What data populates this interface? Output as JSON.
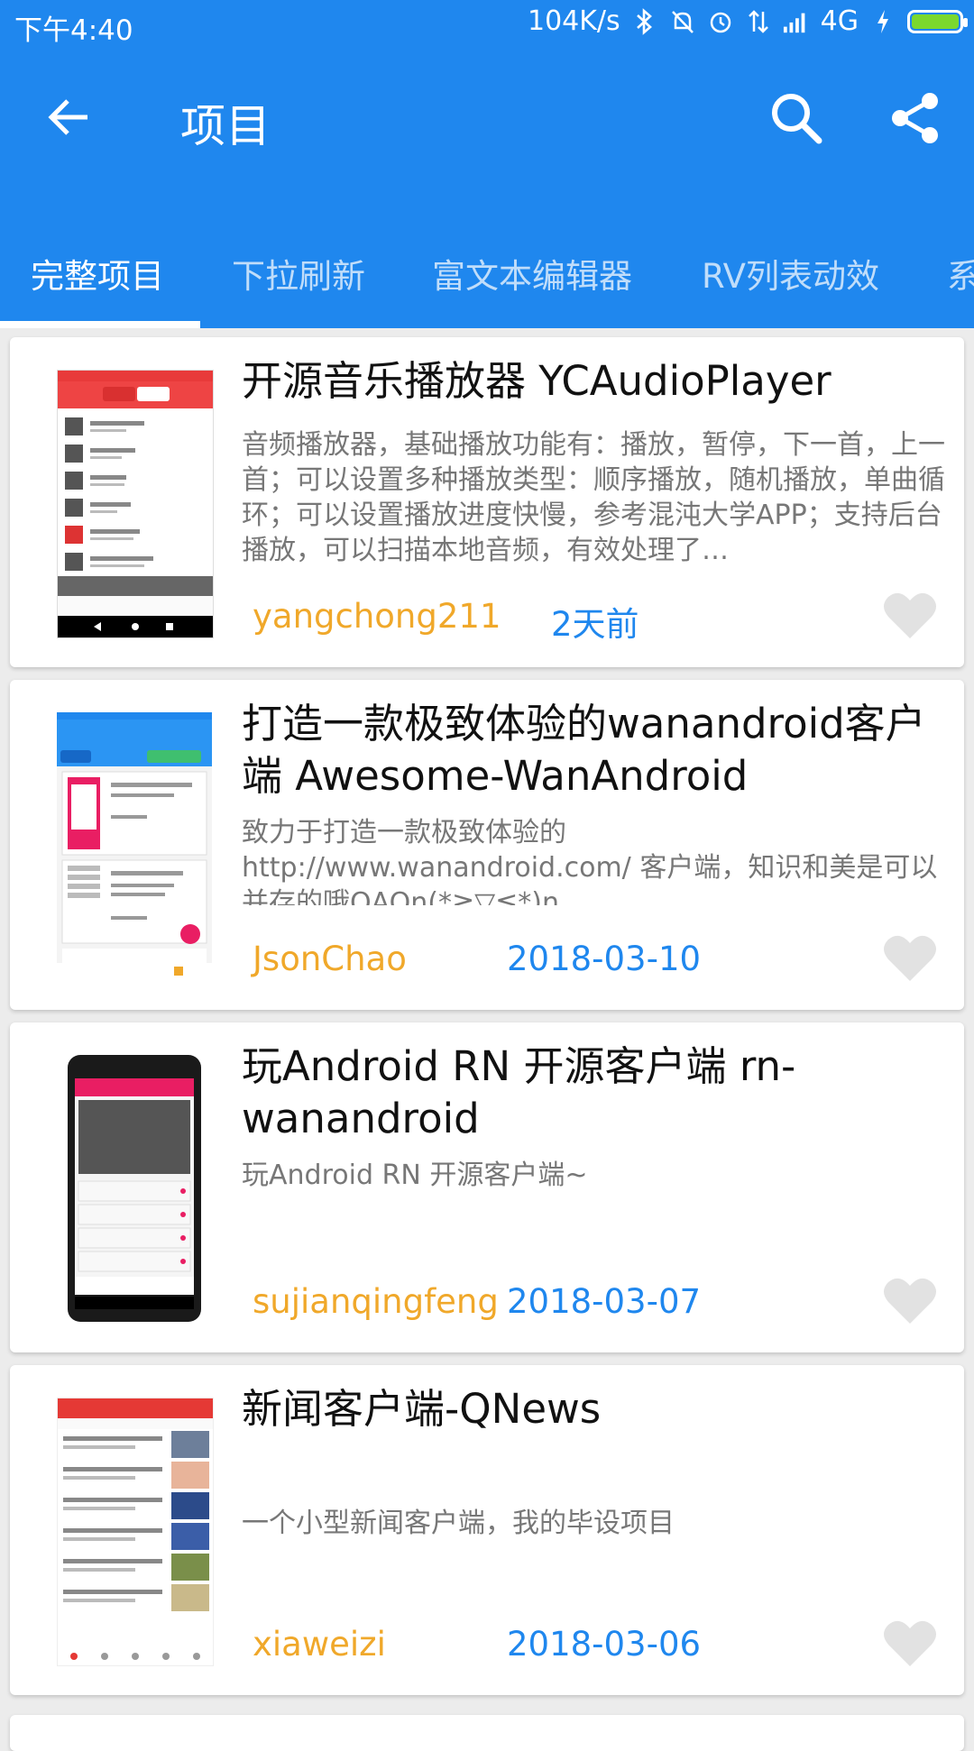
{
  "status_bar": {
    "time": "下午4:40",
    "network_speed": "104K/s",
    "network_type": "4G",
    "icons": [
      "bluetooth-icon",
      "mute-icon",
      "alarm-icon",
      "data-icon",
      "signal-icon",
      "charging-icon",
      "battery-icon"
    ],
    "battery_color": "#7bd82e"
  },
  "toolbar": {
    "title": "项目",
    "back_icon": "arrow-left-icon",
    "search_icon": "search-icon",
    "share_icon": "share-icon",
    "color": "#1f87ee"
  },
  "tabs": [
    {
      "label": "完整项目"
    },
    {
      "label": "下拉刷新"
    },
    {
      "label": "富文本编辑器"
    },
    {
      "label": "RV列表动效"
    },
    {
      "label": "系"
    }
  ],
  "projects": [
    {
      "title": "开源音乐播放器 YCAudioPlayer",
      "desc": "音频播放器，基础播放功能有：播放，暂停，下一首，上一首；可以设置多种播放类型：顺序播放，随机播放，单曲循环；可以设置播放进度快慢，参考混沌大学APP；支持后台播放，可以扫描本地音频，有效处理了…",
      "author": "yangchong211",
      "date": "2天前"
    },
    {
      "title": "打造一款极致体验的wanandroid客户端 Awesome-WanAndroid",
      "desc": "致力于打造一款极致体验的 http://www.wanandroid.com/ 客户端，知识和美是可以并存的哦QAQn(*≧▽≦*)n",
      "author": "JsonChao",
      "date": "2018-03-10"
    },
    {
      "title": "玩Android RN 开源客户端 rn-wanandroid",
      "desc": "玩Android RN 开源客户端~",
      "author": "sujianqingfeng",
      "date": "2018-03-07"
    },
    {
      "title": "新闻客户端-QNews",
      "desc": "一个小型新闻客户端，我的毕设项目",
      "author": "xiaweizi",
      "date": "2018-03-06"
    }
  ],
  "thumb_texts": {
    "p1": [
      "在线音乐",
      "本地音乐"
    ],
    "p2": [
      "项目",
      "完整项目",
      "下拉刷新",
      "玩Android RN 开源客..."
    ],
    "p3": [
      "首页",
      "完整项目合集",
      "兄弟，要不要换个项目学习下?"
    ],
    "p4": [
      "趣闻"
    ]
  }
}
